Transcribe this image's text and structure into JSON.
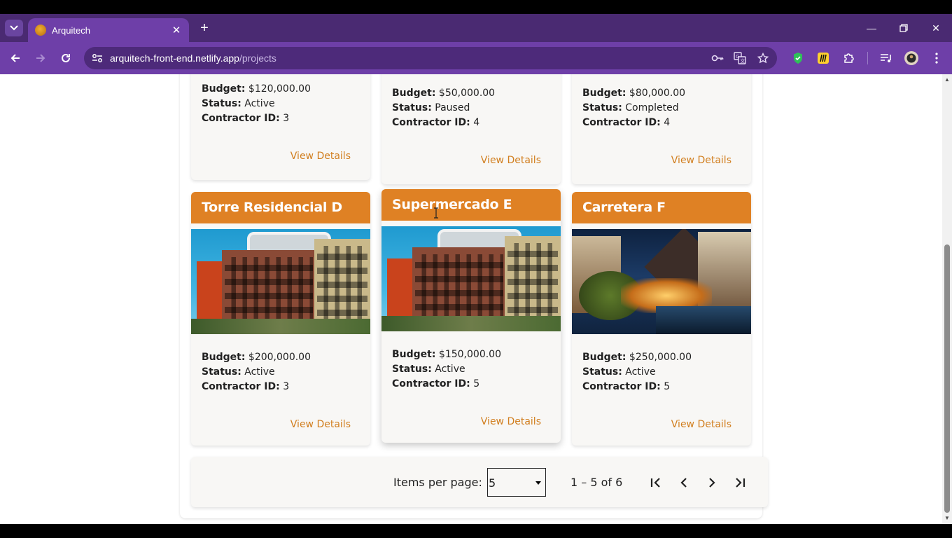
{
  "browser": {
    "tab_title": "Arquitech",
    "url_host": "arquitech-front-end.netlify.app",
    "url_path": "/projects"
  },
  "cards": [
    {
      "budget_label": "Budget:",
      "budget": "$120,000.00",
      "status_label": "Status:",
      "status": "Active",
      "contractor_label": "Contractor ID:",
      "contractor_id": "3",
      "link": "View Details"
    },
    {
      "budget_label": "Budget:",
      "budget": "$50,000.00",
      "status_label": "Status:",
      "status": "Paused",
      "contractor_label": "Contractor ID:",
      "contractor_id": "4",
      "link": "View Details"
    },
    {
      "budget_label": "Budget:",
      "budget": "$80,000.00",
      "status_label": "Status:",
      "status": "Completed",
      "contractor_label": "Contractor ID:",
      "contractor_id": "4",
      "link": "View Details"
    },
    {
      "title": "Torre Residencial D",
      "image": "building-photo",
      "budget_label": "Budget:",
      "budget": "$200,000.00",
      "status_label": "Status:",
      "status": "Active",
      "contractor_label": "Contractor ID:",
      "contractor_id": "3",
      "link": "View Details"
    },
    {
      "title": "Supermercado E",
      "image": "building-photo",
      "budget_label": "Budget:",
      "budget": "$150,000.00",
      "status_label": "Status:",
      "status": "Active",
      "contractor_label": "Contractor ID:",
      "contractor_id": "5",
      "link": "View Details"
    },
    {
      "title": "Carretera F",
      "image": "canal-night-photo",
      "budget_label": "Budget:",
      "budget": "$250,000.00",
      "status_label": "Status:",
      "status": "Active",
      "contractor_label": "Contractor ID:",
      "contractor_id": "5",
      "link": "View Details"
    }
  ],
  "paginator": {
    "items_per_page_label": "Items per page:",
    "items_per_page_value": "5",
    "range": "1 – 5 of 6"
  },
  "colors": {
    "accent": "#df8124",
    "link": "#d17e1e",
    "browser_frame": "#6e3fa8"
  }
}
